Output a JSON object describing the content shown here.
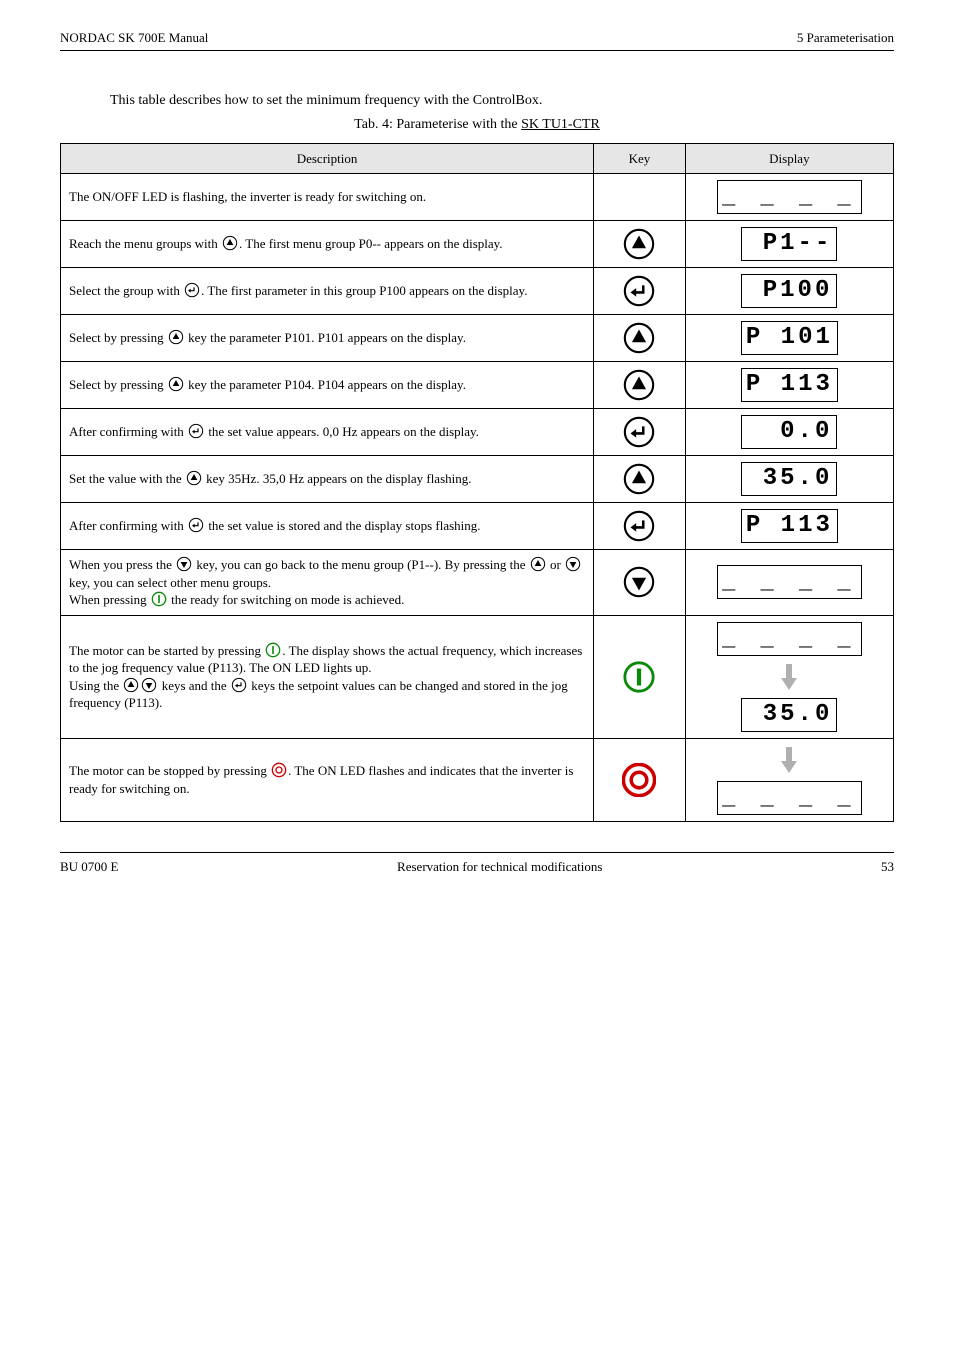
{
  "header": {
    "left": "NORDAC SK 700E  Manual",
    "right_line1": "5   Parameterisation",
    "right_line2": ""
  },
  "pre_caption": "This table describes how to set the minimum frequency with the ControlBox.",
  "caption": {
    "prefix": "Tab. 4: Parameterise with the ",
    "model": "SK TU1-CTR"
  },
  "table": {
    "headers": {
      "col1": "Description",
      "col2": "Key",
      "col3": "Display"
    },
    "rows": [
      {
        "desc_parts": [
          "The ON/OFF LED is flashing, the inverter is ready for switching on."
        ],
        "key_icon": null,
        "display": {
          "type": "lcd",
          "values": [
            "_ _ _ _"
          ]
        }
      },
      {
        "desc_parts": [
          "Reach the menu groups with ",
          {
            "icon": "up"
          },
          ". The first menu group P0-- appears on the display."
        ],
        "key_icon": "up",
        "display": {
          "type": "lcd",
          "values": [
            "P1--"
          ]
        }
      },
      {
        "desc_parts": [
          "Select the group with ",
          {
            "icon": "enter"
          },
          ". The first parameter in this group P100 appears on the display."
        ],
        "key_icon": "enter",
        "display": {
          "type": "lcd",
          "values": [
            "P100"
          ]
        }
      },
      {
        "desc_parts": [
          "Select by pressing ",
          {
            "icon": "up"
          },
          " key the parameter P101. P101 appears on the display."
        ],
        "key_icon": "up",
        "display": {
          "type": "lcd",
          "values": [
            "P 101"
          ]
        }
      },
      {
        "desc_parts": [
          "Select by pressing ",
          {
            "icon": "up"
          },
          " key the parameter P104. P104 appears on the display."
        ],
        "key_icon": "up",
        "display": {
          "type": "lcd",
          "values": [
            "P 113"
          ]
        }
      },
      {
        "desc_parts": [
          "After confirming with ",
          {
            "icon": "enter"
          },
          " the set value appears. 0,0 Hz appears on the display."
        ],
        "key_icon": "enter",
        "display": {
          "type": "lcd",
          "values": [
            "0.0"
          ]
        }
      },
      {
        "desc_parts": [
          "Set the value with the ",
          {
            "icon": "up"
          },
          " key 35Hz. 35,0 Hz appears on the display flashing."
        ],
        "key_icon": "up",
        "display": {
          "type": "lcd",
          "values": [
            "35.0"
          ]
        }
      },
      {
        "desc_parts": [
          "After confirming with ",
          {
            "icon": "enter"
          },
          " the set value is stored and the display stops flashing."
        ],
        "key_icon": "enter",
        "display": {
          "type": "lcd",
          "values": [
            "P 113"
          ]
        }
      },
      {
        "desc_parts": [
          "When you press the ",
          {
            "icon": "down"
          },
          " key, you can go back to the menu group (P1--). By pressing the ",
          {
            "icon": "up"
          },
          " or ",
          {
            "icon": "down"
          },
          " key, you can select other menu groups."
        ],
        "desc_parts2": [
          "When pressing ",
          {
            "icon": "power-sm"
          },
          " the ready for switching on mode is achieved."
        ],
        "key_icon": "down",
        "display": {
          "type": "lcd",
          "values": [
            "_ _ _ _"
          ]
        }
      },
      {
        "desc_parts": [
          "The motor can be started by pressing ",
          {
            "icon": "power-sm"
          },
          ". The display shows the actual frequency, which increases to the jog frequency value (P113). The ON LED lights up."
        ],
        "desc_parts2": [
          "Using the ",
          {
            "icon": "up"
          },
          {
            "icon": "down"
          },
          " keys and the ",
          {
            "icon": "enter"
          },
          " keys the setpoint values can be changed and stored in the jog frequency (P113)."
        ],
        "key_icon": "power",
        "display": {
          "type": "stack",
          "values": [
            "_ _ _ _",
            "arrow",
            "35.0"
          ]
        }
      },
      {
        "desc_parts": [
          "The motor can be stopped by pressing ",
          {
            "icon": "stop-sm"
          },
          ". The ON LED flashes and indicates that the inverter is ready for switching on."
        ],
        "key_icon": "stop",
        "display": {
          "type": "stack",
          "values": [
            "arrow",
            "_ _ _ _"
          ]
        }
      }
    ]
  },
  "footer": {
    "left": "BU 0700 E",
    "center": "Reservation for technical modifications",
    "right": "53"
  }
}
